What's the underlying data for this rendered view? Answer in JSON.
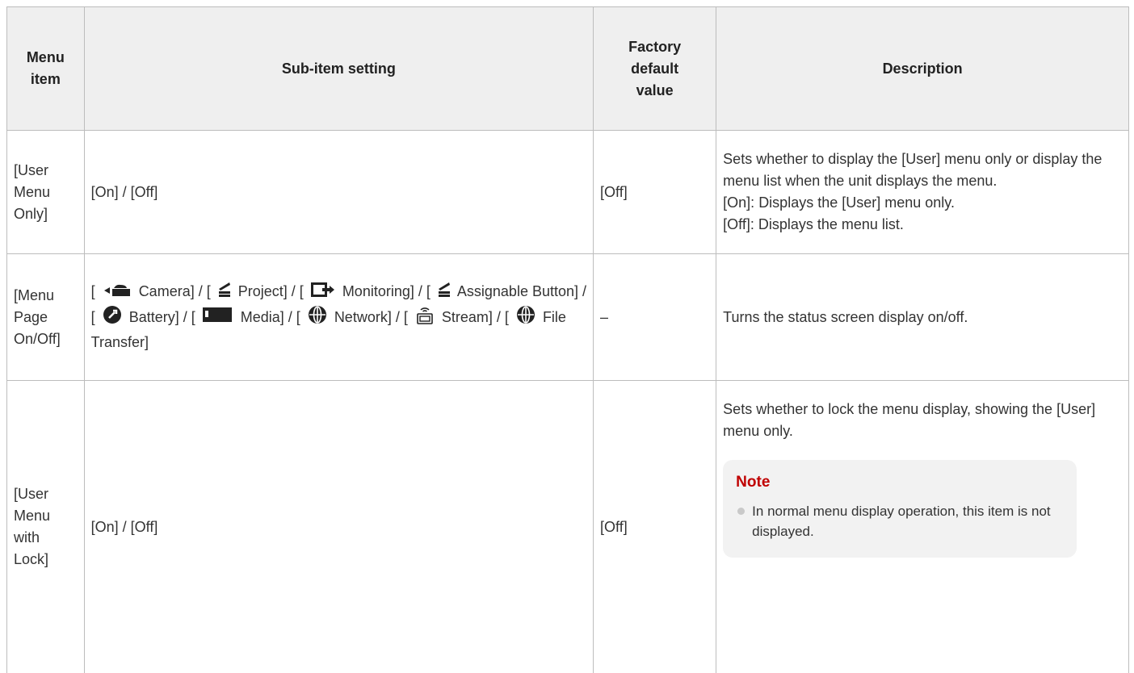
{
  "table": {
    "headers": {
      "menu_item": "Menu item",
      "sub_item_setting": "Sub-item setting",
      "factory_default_line1": "Factory",
      "factory_default_line2": "default",
      "factory_default_line3": "value",
      "description": "Description"
    },
    "rows": [
      {
        "menu_item": "[User Menu Only]",
        "setting": "[On] / [Off]",
        "default": "[Off]",
        "description": [
          "Sets whether to display the [User] menu only or display the menu list when the unit displays the menu.",
          "[On]: Displays the [User] menu only.",
          "[Off]: Displays the menu list."
        ]
      },
      {
        "menu_item": "[Menu Page On/Off]",
        "setting_parts": {
          "p0": "[",
          "camera": "Camera] / [",
          "project": "Project] / [",
          "monitoring": "Monitoring] / [",
          "assignable": "Assignable Button] / [",
          "battery": "Battery] / [",
          "media": "Media] / [",
          "network": "Network] / [",
          "stream": "Stream] / [",
          "file_transfer": "File Transfer]"
        },
        "icons": [
          "camera-icon",
          "project-icon",
          "monitoring-icon",
          "assignable-button-icon",
          "battery-icon",
          "media-icon",
          "network-icon",
          "stream-icon",
          "file-transfer-icon"
        ],
        "default": "–",
        "description": "Turns the status screen display on/off."
      },
      {
        "menu_item": "[User Menu with Lock]",
        "setting": "[On] / [Off]",
        "default": "[Off]",
        "description": "Sets whether to lock the menu display, showing the [User] menu only.",
        "note": {
          "title": "Note",
          "items": [
            "In normal menu display operation, this item is not displayed."
          ]
        }
      }
    ]
  },
  "colors": {
    "note_title": "#c00000",
    "header_bg": "#efefef",
    "note_bg": "#f2f2f2",
    "border": "#bdbdbd"
  }
}
